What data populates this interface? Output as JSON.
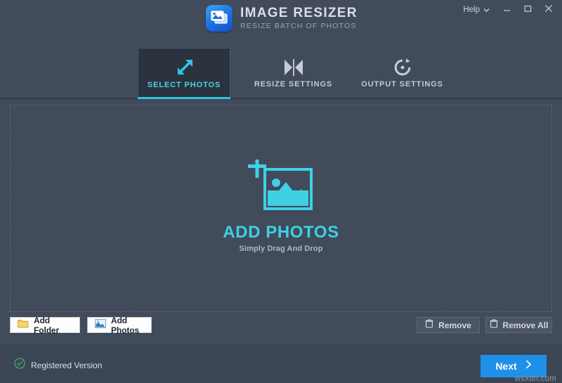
{
  "window": {
    "app_title": "IMAGE RESIZER",
    "app_subtitle": "RESIZE BATCH OF PHOTOS",
    "app_icon": "photos-stack-icon",
    "help_label": "Help",
    "help_chevron_icon": "chevron-down-icon",
    "minimize_icon": "minimize-icon",
    "maximize_icon": "maximize-icon",
    "close_icon": "close-icon"
  },
  "tabs": [
    {
      "label": "SELECT PHOTOS",
      "icon": "resize-arrows-diagonal-icon",
      "active": true
    },
    {
      "label": "RESIZE SETTINGS",
      "icon": "collapse-horizontal-icon",
      "active": false
    },
    {
      "label": "OUTPUT SETTINGS",
      "icon": "refresh-circle-icon",
      "active": false
    }
  ],
  "dropzone": {
    "icon": "add-image-icon",
    "title": "ADD PHOTOS",
    "subtitle": "Simply Drag And Drop"
  },
  "actions": {
    "add_folder_label": "Add Folder",
    "add_folder_icon": "folder-icon",
    "add_photos_label": "Add Photos",
    "add_photos_icon": "image-thumbnail-icon",
    "remove_label": "Remove",
    "remove_icon": "trash-icon",
    "remove_all_label": "Remove All",
    "remove_all_icon": "trash-icon"
  },
  "footer": {
    "registered_label": "Registered Version",
    "registered_icon": "check-circle-icon",
    "next_label": "Next",
    "next_icon": "chevron-right-icon"
  },
  "watermark": "wsxdn.com",
  "colors": {
    "window_bg": "#414b5a",
    "active_tab_bg": "#2b333f",
    "accent_cyan": "#2ec5dd",
    "accent_cyan_text": "#4fd2e8",
    "next_blue": "#1e90e8",
    "registered_green": "#3f9e6d",
    "footer_bg": "#3b4553"
  }
}
